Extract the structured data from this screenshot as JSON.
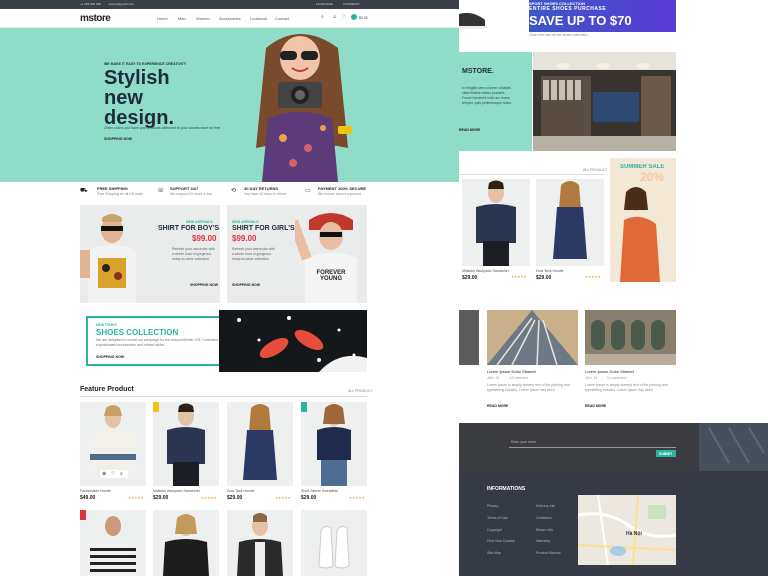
{
  "topbar": {
    "phone": "+1 999 999 999",
    "email": "mstore@gmail.com",
    "language": "LANGUAGE",
    "currency": "CURRENCY"
  },
  "nav": {
    "logo": "mstore",
    "links": [
      "Home",
      "Men",
      "Women",
      "Accessories",
      "Lookbook",
      "Contact"
    ],
    "cart_total": "$0.00"
  },
  "hero": {
    "tagline": "WE MAKE IT EASY TO EXPERIENCE CREATIVITY",
    "title_lines": [
      "Stylish",
      "new",
      "design."
    ],
    "body": "Order online and have your products delivered to your closest store for free",
    "cta": "SHOPPING NOW"
  },
  "features": [
    {
      "title": "FREE SHIPPING",
      "sub": "Free Shipping for all US order"
    },
    {
      "title": "SUPPORT 24/7",
      "sub": "We support 24 hours a day"
    },
    {
      "title": "30 DAY RETURNS",
      "sub": "You have 30 days to return"
    },
    {
      "title": "PAYMENT 100% SECURE",
      "sub": "We ensure secure payment"
    }
  ],
  "promo_boys": {
    "tag": "NEW ARRIVALS",
    "title": "SHIRT FOR BOY'S",
    "price": "$99.00",
    "body": "Refresh your wardrobe with a whole host of gorgeous ready-to-wear collection",
    "cta": "SHOPPING NOW"
  },
  "promo_girls": {
    "tag": "NEW ARRIVALS",
    "title": "SHIRT FOR GIRL'S",
    "price": "$99.00",
    "body": "Refresh your wardrobe with a whole host of gorgeous ready-to-wear collection",
    "cta": "SHOPPING NOW",
    "shirt_text": "FOREVER YOUNG"
  },
  "shoes": {
    "tag": "NEW ITEM'S",
    "title": "SHOES COLLECTION",
    "body": "We are delighted to reveal our campaign for the Autumn/Winter 2017 collection, featuring sophisticated accessories and refined styles.",
    "cta": "SHOPPING NOW"
  },
  "featured": {
    "title": "Feature Product",
    "all_link": "ALL PRODUCT",
    "products": [
      {
        "name": "Fashionable Hoodie",
        "price": "$49.00",
        "stars": "★★★★★"
      },
      {
        "name": "Midsider Backpack Sweatshirt",
        "price": "$29.00",
        "stars": "★★★★★"
      },
      {
        "name": "Dots Tank Hoodie",
        "price": "$29.00",
        "stars": "★★★★★"
      },
      {
        "name": "Short Sleeve Sweatshirt",
        "price": "$29.00",
        "stars": "★★★★★"
      }
    ]
  },
  "right_banner": {
    "line1": "SPORT SHOES COLLECTION",
    "line2": "ENTIRE SHOES PURCHASE",
    "line3": "SAVE UP TO $70",
    "link": "Click here see all the shoes collection..."
  },
  "about": {
    "title": "MSTORE.",
    "body": "In fringilla sem a lorem volutpat, vitae finibus metus posuere. Fusce hendrerit velit nec lorem tempor, quis pellentesque tortor.",
    "cta": "READ MORE"
  },
  "right_products": {
    "all_link": "ALL PRODUCT",
    "items": [
      {
        "name": "Midsider Backpack Sweatshirt",
        "price": "$29.00",
        "stars": "★★★★★"
      },
      {
        "name": "Dots Tank Hoodie",
        "price": "$29.00",
        "stars": "★★★★★"
      }
    ],
    "sale_line1": "SUMMER SALE",
    "sale_line2": "20%"
  },
  "blog": [
    {
      "title": "Lorem Ipsum Dolor Sitamet",
      "date": "JAN, 24",
      "comments": "14 comment",
      "body": "Lorem ipsum is simply dummy text of the printing and typesetting industry. Lorem Ipsum has been",
      "cta": "READ MORE"
    },
    {
      "title": "Lorem Ipsum Dolor Sitamet",
      "date": "JAN, 24",
      "comments": "14 comment",
      "body": "Lorem ipsum is simply dummy text of the printing and typesetting industry. Lorem Ipsum has been",
      "cta": "READ MORE"
    }
  ],
  "newsletter": {
    "placeholder": "Enter your email",
    "button": "SUBMIT"
  },
  "footer": {
    "title": "INFORMATIONS",
    "col1": [
      "Privacy",
      "Terms of Use",
      "Copyright",
      "Find Your Country",
      "Site Map"
    ],
    "col2": [
      "Delivery Info",
      "Contactus",
      "Return Info",
      "Warranty",
      "Product Manual"
    ],
    "map_label": "Hà Nội"
  }
}
